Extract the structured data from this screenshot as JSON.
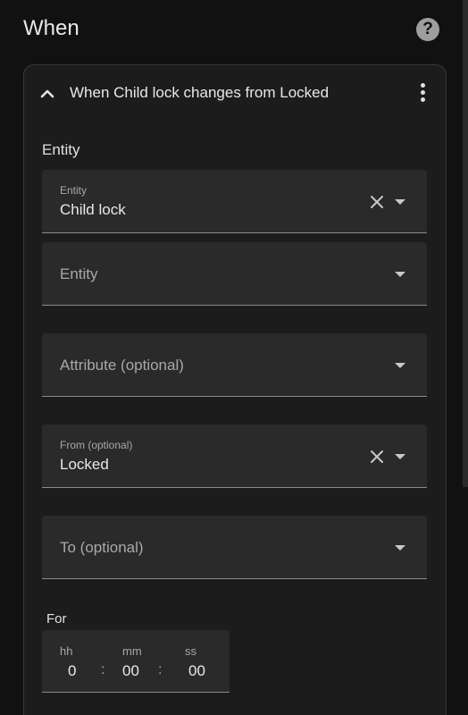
{
  "header": {
    "title": "When",
    "help_icon_glyph": "?"
  },
  "card": {
    "title": "When Child lock changes from Locked",
    "section_label": "Entity",
    "fields": [
      {
        "label": "Entity",
        "value": "Child lock",
        "clearable": true
      },
      {
        "placeholder": "Entity"
      },
      {
        "placeholder": "Attribute (optional)"
      },
      {
        "label": "From (optional)",
        "value": "Locked",
        "clearable": true
      },
      {
        "placeholder": "To (optional)"
      }
    ],
    "for_label": "For",
    "duration": {
      "hh_label": "hh",
      "hh_value": "0",
      "mm_label": "mm",
      "mm_value": "00",
      "ss_label": "ss",
      "ss_value": "00",
      "separator": ":"
    }
  },
  "icons": {
    "help": "help-circle-icon",
    "collapse": "chevron-up-icon",
    "menu": "more-vertical-icon",
    "clear": "close-icon",
    "dropdown": "caret-down-icon"
  },
  "colors": {
    "background": "#111111",
    "card": "#1c1c1c",
    "field": "#2a2a2a",
    "text": "#e8e8e8",
    "secondary_text": "#a8a8a8"
  }
}
